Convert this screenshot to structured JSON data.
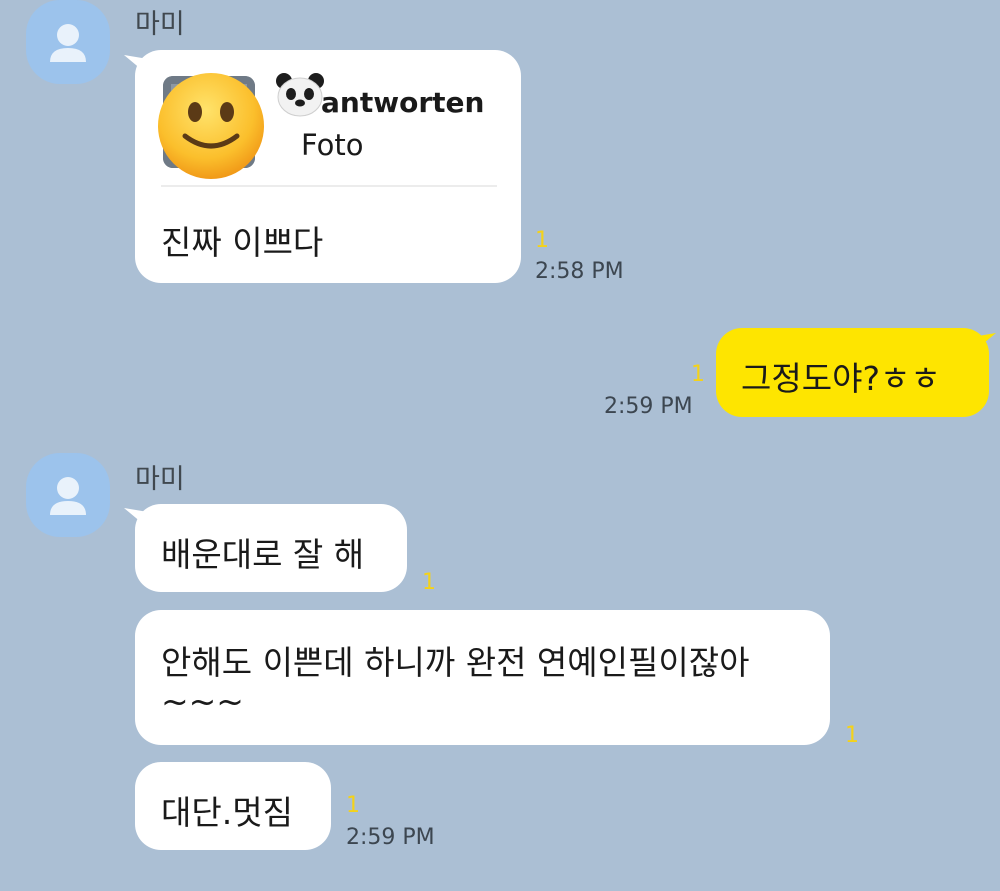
{
  "sender_name": "마미",
  "messages": {
    "m1": {
      "reply_name": "antworten",
      "reply_type": "Foto",
      "text": "진짜 이쁘다",
      "unread": "1",
      "time": "2:58 PM"
    },
    "m2": {
      "text": "그정도야?ㅎㅎ",
      "unread": "1",
      "time": "2:59 PM"
    },
    "m3": {
      "text": "배운대로 잘 해",
      "unread": "1"
    },
    "m4": {
      "line1": "안해도 이쁜데 하니까 완전 연예인필이잖아",
      "line2": "~~~",
      "unread": "1"
    },
    "m5": {
      "text": "대단.멋짐",
      "unread": "1",
      "time": "2:59 PM"
    }
  },
  "icons": {
    "avatar": "person-icon",
    "reply_emoji": "slightly-smiling-face",
    "reply_avatar_emoji": "bear-face"
  },
  "colors": {
    "background": "#abbfd4",
    "my_bubble": "#fee500",
    "their_bubble": "#ffffff",
    "unread_count": "#f4d21a"
  }
}
